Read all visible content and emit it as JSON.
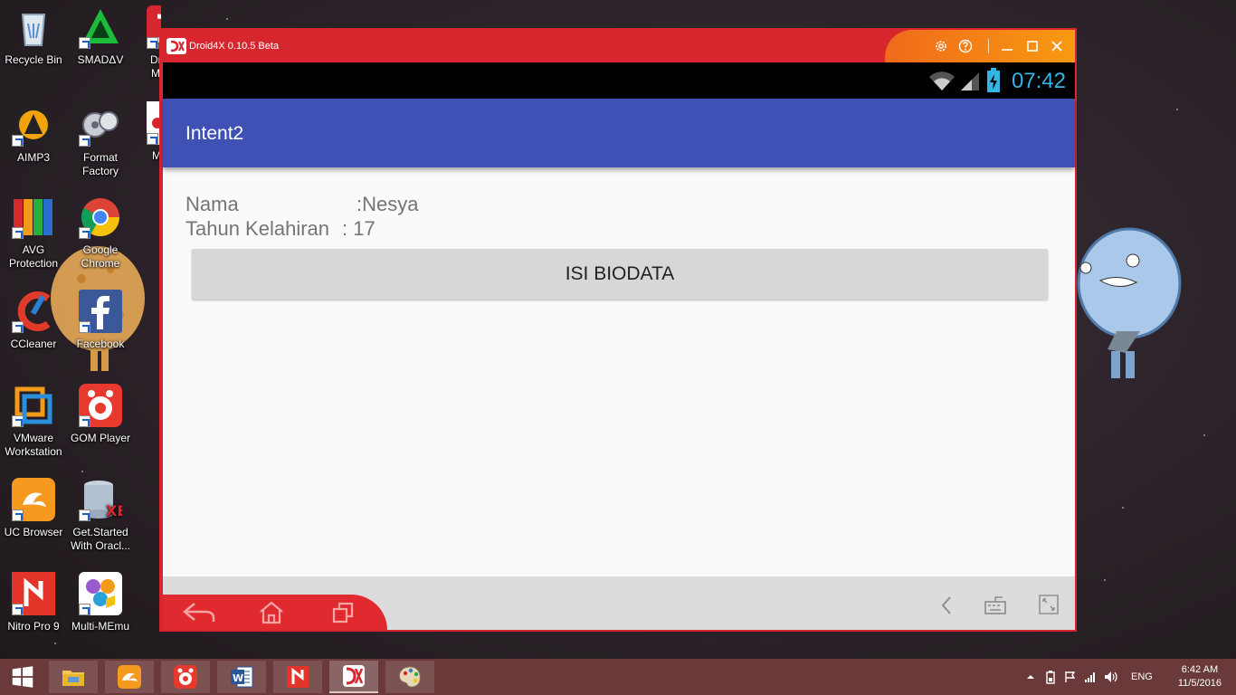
{
  "desktop": {
    "icons": [
      {
        "label": "Recycle Bin"
      },
      {
        "label": "SMADΔV"
      },
      {
        "label": "Dr M"
      },
      {
        "label": "AIMP3"
      },
      {
        "label": "Format Factory"
      },
      {
        "label": "M"
      },
      {
        "label": "AVG Protection"
      },
      {
        "label": "Google Chrome"
      },
      {
        "label": "CCleaner"
      },
      {
        "label": "Facebook"
      },
      {
        "label": "VMware Workstation"
      },
      {
        "label": "GOM Player"
      },
      {
        "label": "UC Browser"
      },
      {
        "label": "Get.Started With Oracl..."
      },
      {
        "label": "Nitro Pro 9"
      },
      {
        "label": "Multi-MEmu"
      }
    ]
  },
  "emulator": {
    "title": "Droid4X 0.10.5 Beta",
    "status_time": "07:42",
    "accent": "#d8262e",
    "app": {
      "title": "Intent2",
      "primary_color": "#3f51b5",
      "name_label": "Nama",
      "name_value": ":Nesya",
      "year_label": "Tahun Kelahiran",
      "year_value": ": 17",
      "button_label": "ISI BIODATA"
    }
  },
  "taskbar": {
    "apps": [
      "File Explorer",
      "UC Browser",
      "GOM Player",
      "Microsoft Word",
      "Nitro Pro",
      "Droid4X",
      "Paint"
    ],
    "language": "ENG",
    "time": "6:42 AM",
    "date": "11/5/2016"
  }
}
